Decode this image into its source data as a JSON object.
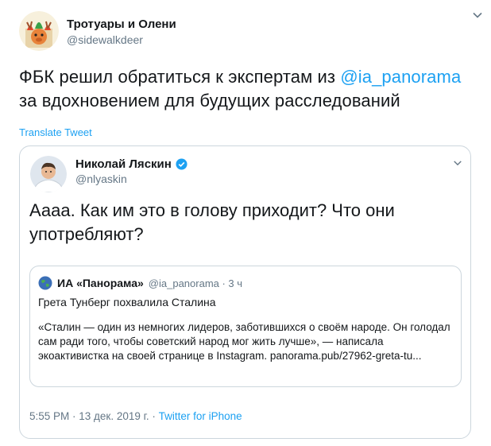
{
  "tweet": {
    "author_name": "Тротуары и Олени",
    "author_handle": "@sidewalkdeer",
    "text_before": "ФБК решил обратиться к экспертам из ",
    "mention": "@ia_panorama",
    "text_after": " за вдохновением для будущих расследований",
    "translate_label": "Translate Tweet"
  },
  "quote": {
    "author_name": "Николай Ляскин",
    "author_handle": "@nlyaskin",
    "text": "Аааа. Как им это в голову приходит? Что они употребляют?",
    "nested": {
      "author_name": "ИА «Панорама»",
      "meta": "@ia_panorama · 3 ч",
      "headline": "Грета Тунберг похвалила Сталина",
      "body": "«Сталин — один из немногих лидеров, заботившихся о своём народе. Он голодал сам ради того, чтобы советский народ мог жить лучше», — написала экоактивистка на своей странице в Instagram. panorama.pub/27962-greta-tu..."
    },
    "footer_time": "5:55 PM · 13 дек. 2019 г. · ",
    "footer_source": "Twitter for iPhone"
  },
  "colors": {
    "link": "#1da1f2",
    "secondary_text": "#657786",
    "border": "#ccd6dd"
  },
  "icons": [
    "caret-down-icon",
    "verified-icon",
    "globe-icon"
  ]
}
